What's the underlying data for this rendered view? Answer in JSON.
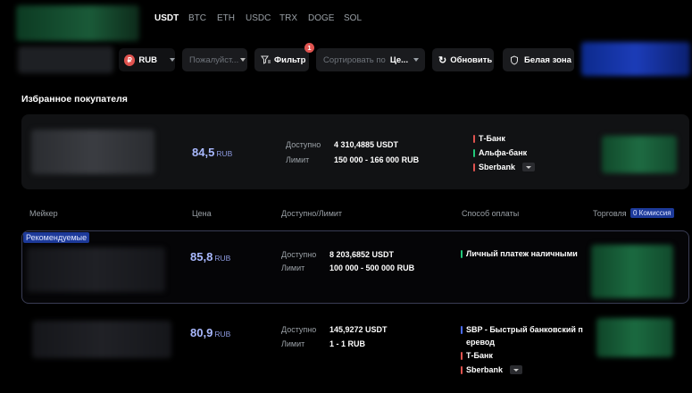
{
  "crypto_tabs": [
    "USDT",
    "BTC",
    "ETH",
    "USDC",
    "TRX",
    "DOGE",
    "SOL"
  ],
  "toolbar": {
    "currency": "RUB",
    "amount_placeholder": "Пожалуйст...",
    "filter_label": "Фильтр",
    "filter_badge": "1",
    "sort_placeholder": "Сортировать по",
    "sort_value": "Це...",
    "refresh_label": "Обновить",
    "whitezone_label": "Белая зона"
  },
  "favorites_title": "Избранное покупателя",
  "labels": {
    "available": "Доступно",
    "limit": "Лимит"
  },
  "favorite_offer": {
    "price": "84,5",
    "currency": "RUB",
    "available": "4 310,4885 USDT",
    "limit": "150 000 - 166 000 RUB",
    "payments": [
      "Т-Банк",
      "Альфа-банк",
      "Sberbank"
    ]
  },
  "table_headers": {
    "maker": "Мейкер",
    "price": "Цена",
    "available_limit": "Доступно/Лимит",
    "payment": "Способ оплаты",
    "trade": "Торговля",
    "commission_badge": "0 Комиссия"
  },
  "offers": [
    {
      "badge": "Рекомендуемые",
      "price": "85,8",
      "currency": "RUB",
      "available": "8 203,6852 USDT",
      "limit": "100 000 - 500 000 RUB",
      "payments": [
        "Личный платеж наличными"
      ]
    },
    {
      "price": "80,9",
      "currency": "RUB",
      "available": "145,9272 USDT",
      "limit": "1 - 1 RUB",
      "payments": [
        "SBP - Быстрый банковский п",
        "еревод",
        "Т-Банк",
        "Sberbank"
      ]
    }
  ],
  "colors": {
    "price": "#a9b9ff",
    "bank_red": "#e0534f",
    "bank_green": "#21c87a",
    "bank_blue": "#4b6dff",
    "badge_blue": "#1d3a9a"
  }
}
